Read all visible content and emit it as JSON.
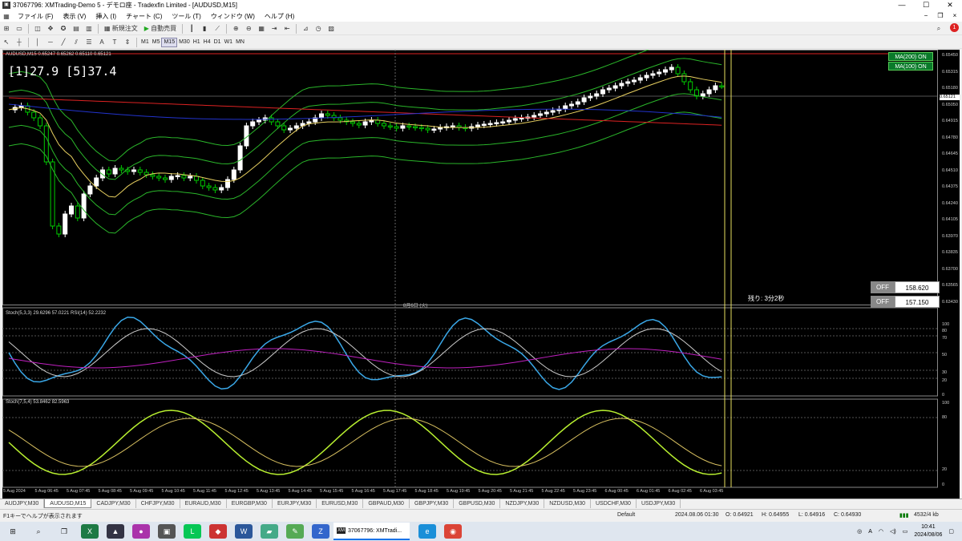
{
  "window": {
    "title": "37067796: XMTrading-Demo 5 - デモロ座 - Tradexfin Limited - [AUDUSD,M15]"
  },
  "menu": [
    "ファイル (F)",
    "表示 (V)",
    "挿入 (I)",
    "チャート (C)",
    "ツール (T)",
    "ウィンドウ (W)",
    "ヘルプ (H)"
  ],
  "toolbar": {
    "new_order": "新規注文",
    "auto_trade": "自動売買",
    "notif_count": "1",
    "tf": [
      "M1",
      "M5",
      "M15",
      "M30",
      "H1",
      "H4",
      "D1",
      "W1",
      "MN"
    ]
  },
  "chart": {
    "info": "AUDUSD,M15  0.65247 0.65262 0.65110 0.65121",
    "timer": "[1]27.9 [5]37.4",
    "date_sep": "8月6日 (火)",
    "remain": "残り: 3分2秒",
    "ma200": "MA(200) ON",
    "ma100": "MA(100) ON",
    "off1": "OFF",
    "val1": "158.620",
    "off2": "OFF",
    "val2": "157.150",
    "sub1": "Stoch(5,3,3) 29.6296 57.0221  RSI(14) 52.2232",
    "sub2": "Stoch(7,5,4) 53.8462 82.5963",
    "price_axis": [
      "0.65450",
      "0.65315",
      "0.65180",
      "0.65050",
      "0.64915",
      "0.64780",
      "0.64645",
      "0.64510",
      "0.64375",
      "0.64240",
      "0.64105",
      "0.63970",
      "0.63835",
      "0.63700",
      "0.63565",
      "0.63430"
    ],
    "current_price": "0.65121",
    "sub1_levels": [
      "100",
      "80",
      "70",
      "50",
      "30",
      "20",
      "0"
    ],
    "sub2_levels": [
      "100",
      "80",
      "20",
      "0"
    ],
    "time_axis": [
      "5 Aug 2024",
      "5 Aug 06:45",
      "5 Aug 07:45",
      "5 Aug 08:45",
      "5 Aug 09:45",
      "5 Aug 10:45",
      "5 Aug 11:45",
      "5 Aug 12:45",
      "5 Aug 13:45",
      "5 Aug 14:45",
      "5 Aug 15:45",
      "5 Aug 16:45",
      "5 Aug 17:45",
      "5 Aug 18:45",
      "5 Aug 19:45",
      "5 Aug 20:45",
      "5 Aug 21:45",
      "5 Aug 22:45",
      "5 Aug 23:45",
      "6 Aug 00:45",
      "6 Aug 01:45",
      "6 Aug 02:45",
      "6 Aug 03:45"
    ]
  },
  "tabs": [
    "AUDJPY,M30",
    "AUDUSD,M15",
    "CADJPY,M30",
    "CHFJPY,M30",
    "EURAUD,M30",
    "EURGBP,M30",
    "EURJPY,M30",
    "EURUSD,M30",
    "GBPAUD,M30",
    "GBPJPY,M30",
    "GBPUSD,M30",
    "NZDJPY,M30",
    "NZDUSD,M30",
    "USDCHF,M30",
    "USDJPY,M30"
  ],
  "status": {
    "help": "F1キーでヘルプが表示されます",
    "profile": "Default",
    "datetime": "2024.08.06 01:30",
    "o": "O: 0.64921",
    "h": "H: 0.64955",
    "l": "L: 0.64916",
    "c": "C: 0.64930",
    "traffic": "4532/4 kb"
  },
  "taskbar": {
    "app": "37067796: XMTradi...",
    "time": "10:41",
    "date": "2024/08/06",
    "lang": "A"
  },
  "colors": {
    "bull": "#ffffff",
    "bear": "#00cc00",
    "bollinger": "#2ab52a",
    "ma_red": "#d22",
    "ma_blue": "#2233cc",
    "ma_yellow": "#e8d060",
    "stoch_main": "#3aa8e8",
    "rsi": "#c020c0",
    "stoch2": "#b8f030"
  }
}
